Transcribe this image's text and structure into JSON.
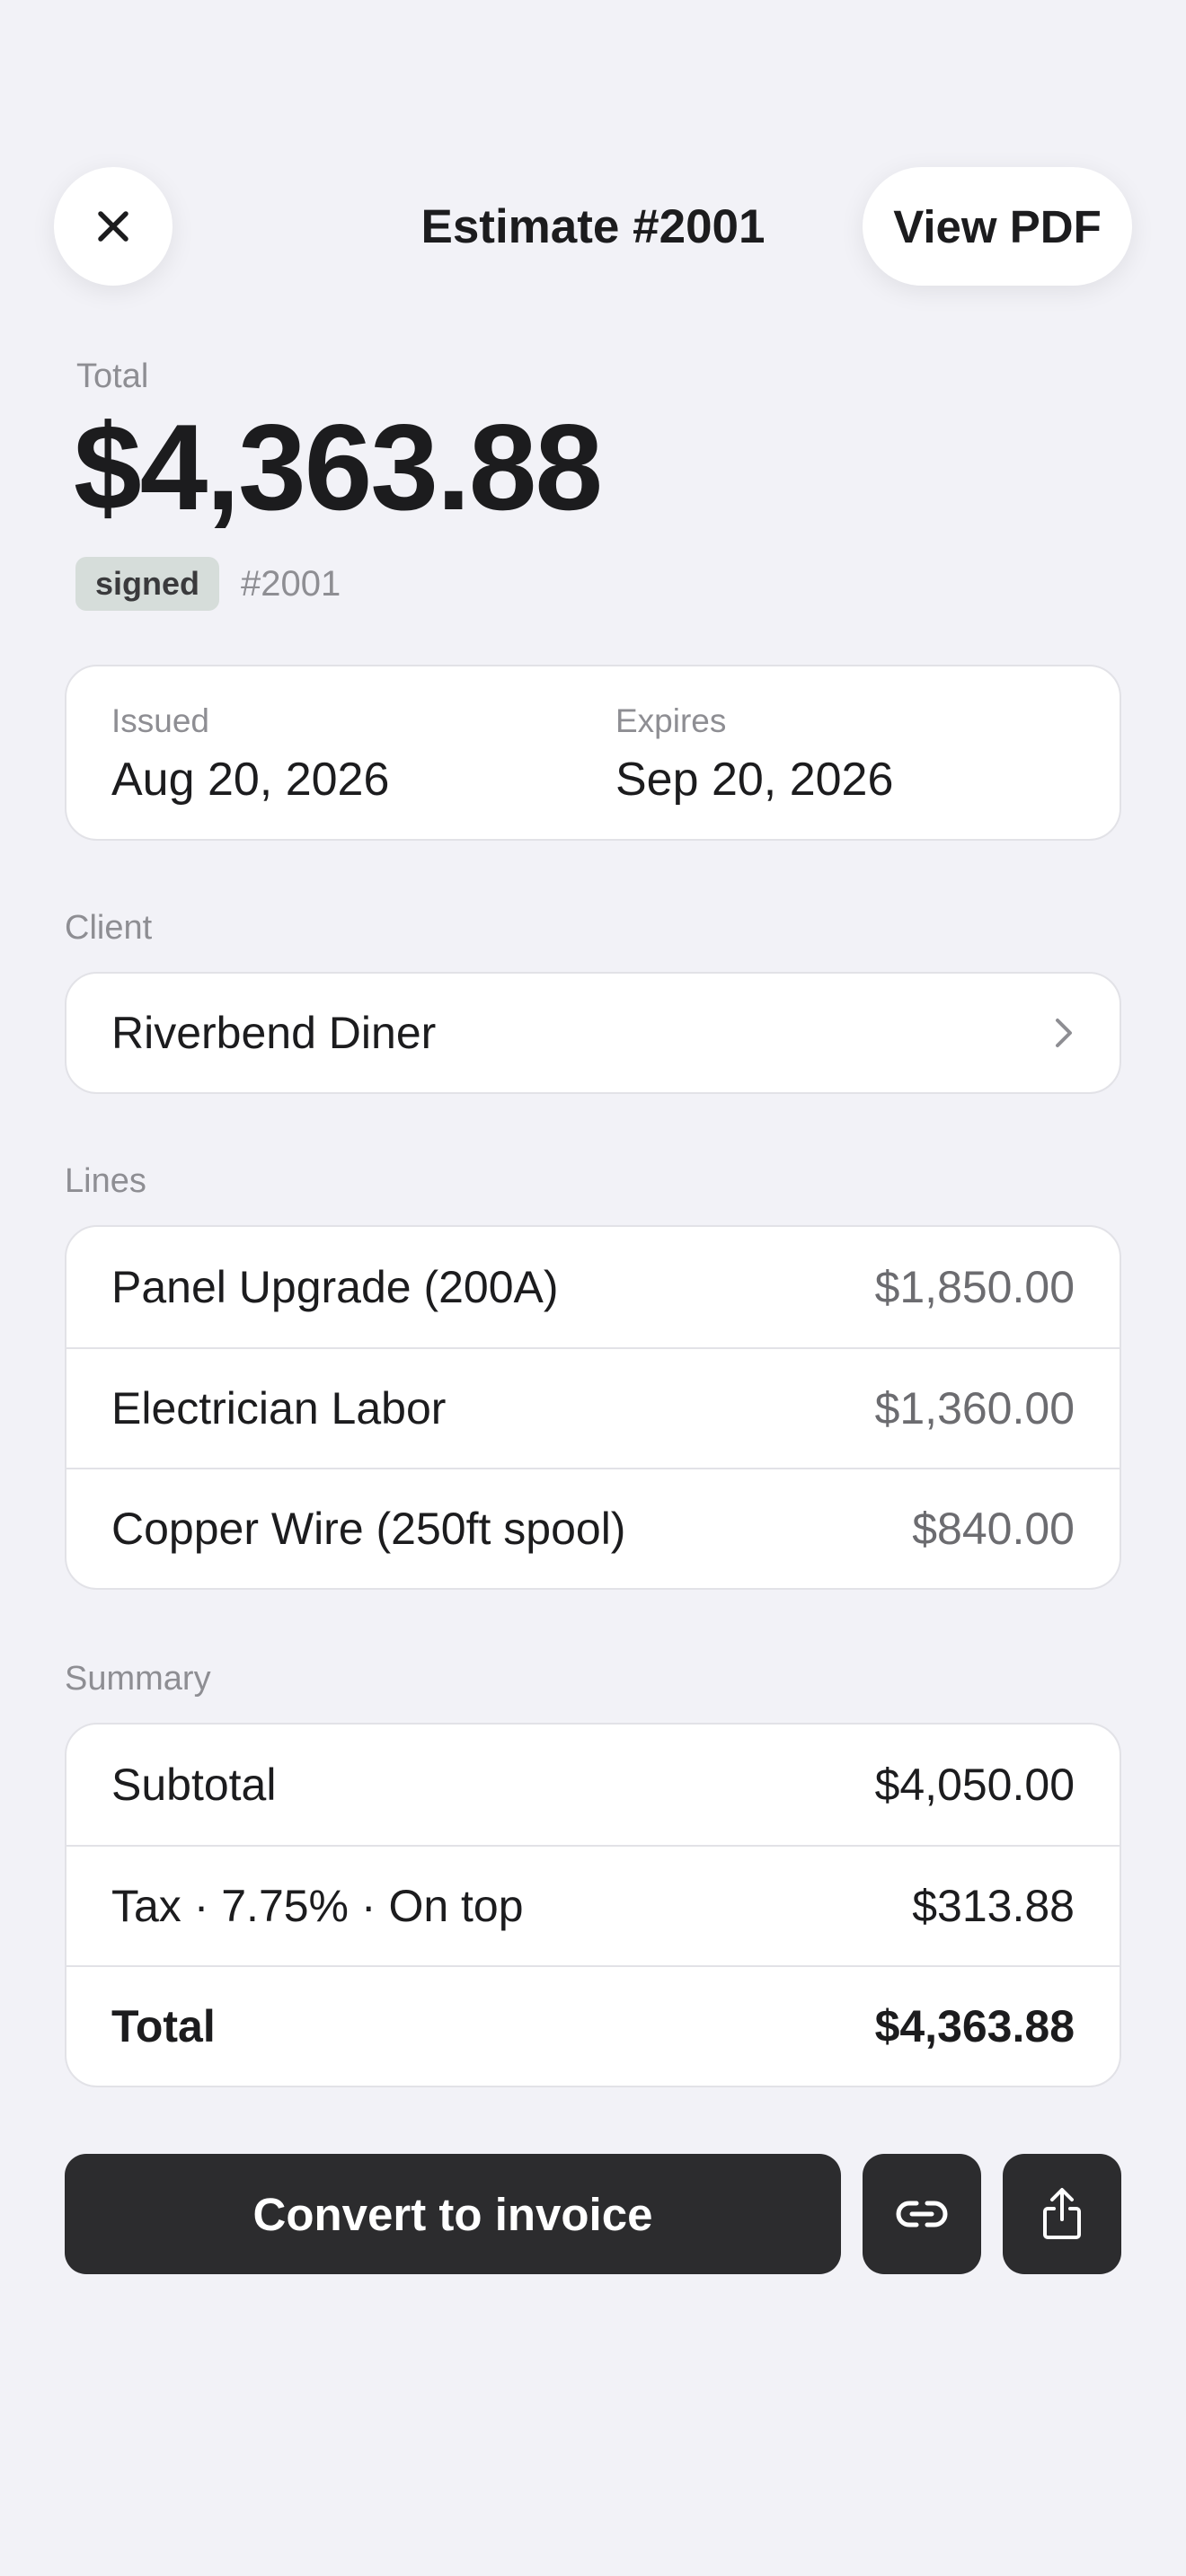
{
  "header": {
    "close_icon": "close-icon",
    "title": "Estimate #2001",
    "view_pdf_label": "View PDF"
  },
  "total": {
    "label": "Total",
    "amount": "$4,363.88",
    "status_badge": "signed",
    "number": "#2001"
  },
  "dates": {
    "issued_label": "Issued",
    "issued_value": "Aug 20, 2026",
    "expires_label": "Expires",
    "expires_value": "Sep 20, 2026"
  },
  "client": {
    "section_label": "Client",
    "name": "Riverbend Diner",
    "chevron_icon": "chevron-right-icon"
  },
  "lines": {
    "section_label": "Lines",
    "items": [
      {
        "name": "Panel Upgrade (200A)",
        "amount": "$1,850.00"
      },
      {
        "name": "Electrician Labor",
        "amount": "$1,360.00"
      },
      {
        "name": "Copper Wire (250ft spool)",
        "amount": "$840.00"
      }
    ]
  },
  "summary": {
    "section_label": "Summary",
    "subtotal_label": "Subtotal",
    "subtotal_value": "$4,050.00",
    "tax_label": "Tax · 7.75% · On top",
    "tax_value": "$313.88",
    "total_label": "Total",
    "total_value": "$4,363.88"
  },
  "actions": {
    "convert_label": "Convert to invoice",
    "link_icon": "link-icon",
    "share_icon": "share-icon"
  },
  "colors": {
    "background": "#f2f2f7",
    "card": "#ffffff",
    "primary_button": "#2c2c2e",
    "status_badge_bg": "#d6ddda",
    "secondary_text": "#8e8e93"
  }
}
